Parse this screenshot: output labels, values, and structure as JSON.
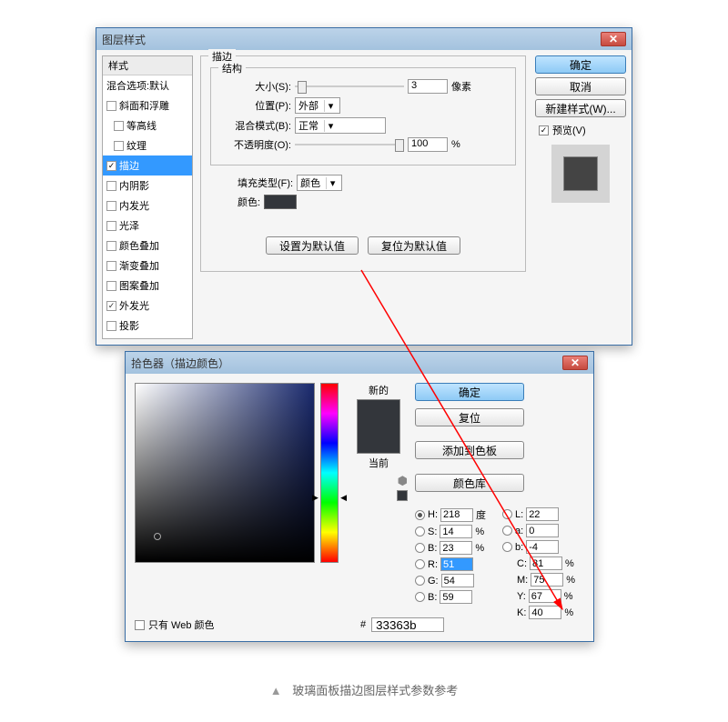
{
  "layerStyle": {
    "title": "图层样式",
    "left": {
      "header": "样式",
      "blendDefault": "混合选项:默认",
      "items": [
        {
          "label": "斜面和浮雕",
          "checked": false
        },
        {
          "label": "等高线",
          "checked": false
        },
        {
          "label": "纹理",
          "checked": false
        },
        {
          "label": "描边",
          "checked": true,
          "active": true
        },
        {
          "label": "内阴影",
          "checked": false
        },
        {
          "label": "内发光",
          "checked": false
        },
        {
          "label": "光泽",
          "checked": false
        },
        {
          "label": "颜色叠加",
          "checked": false
        },
        {
          "label": "渐变叠加",
          "checked": false
        },
        {
          "label": "图案叠加",
          "checked": false
        },
        {
          "label": "外发光",
          "checked": true
        },
        {
          "label": "投影",
          "checked": false
        }
      ]
    },
    "stroke": {
      "groupTitle": "描边",
      "structTitle": "结构",
      "sizeLabel": "大小(S):",
      "sizeValue": "3",
      "sizeUnit": "像素",
      "positionLabel": "位置(P):",
      "positionValue": "外部",
      "blendModeLabel": "混合模式(B):",
      "blendModeValue": "正常",
      "opacityLabel": "不透明度(O):",
      "opacityValue": "100",
      "opacityUnit": "%",
      "fillTypeLabel": "填充类型(F):",
      "fillTypeValue": "颜色",
      "colorLabel": "颜色:",
      "colorSwatch": "#33363b",
      "btnDefault": "设置为默认值",
      "btnReset": "复位为默认值"
    },
    "right": {
      "ok": "确定",
      "cancel": "取消",
      "newStyle": "新建样式(W)...",
      "previewLabel": "预览(V)"
    }
  },
  "colorPicker": {
    "title": "拾色器（描边颜色）",
    "newLabel": "新的",
    "currentLabel": "当前",
    "ok": "确定",
    "cancel": "复位",
    "addSwatch": "添加到色板",
    "colorLib": "颜色库",
    "H": {
      "label": "H:",
      "value": "218",
      "unit": "度"
    },
    "S": {
      "label": "S:",
      "value": "14",
      "unit": "%"
    },
    "Bv": {
      "label": "B:",
      "value": "23",
      "unit": "%"
    },
    "R": {
      "label": "R:",
      "value": "51"
    },
    "G": {
      "label": "G:",
      "value": "54"
    },
    "Bb": {
      "label": "B:",
      "value": "59"
    },
    "L": {
      "label": "L:",
      "value": "22"
    },
    "a": {
      "label": "a:",
      "value": "0"
    },
    "b": {
      "label": "b:",
      "value": "-4"
    },
    "C": {
      "label": "C:",
      "value": "81",
      "unit": "%"
    },
    "M": {
      "label": "M:",
      "value": "75",
      "unit": "%"
    },
    "Y": {
      "label": "Y:",
      "value": "67",
      "unit": "%"
    },
    "K": {
      "label": "K:",
      "value": "40",
      "unit": "%"
    },
    "hexLabel": "#",
    "hexValue": "33363b",
    "webOnly": "只有 Web 颜色"
  },
  "caption": "玻璃面板描边图层样式参数参考"
}
